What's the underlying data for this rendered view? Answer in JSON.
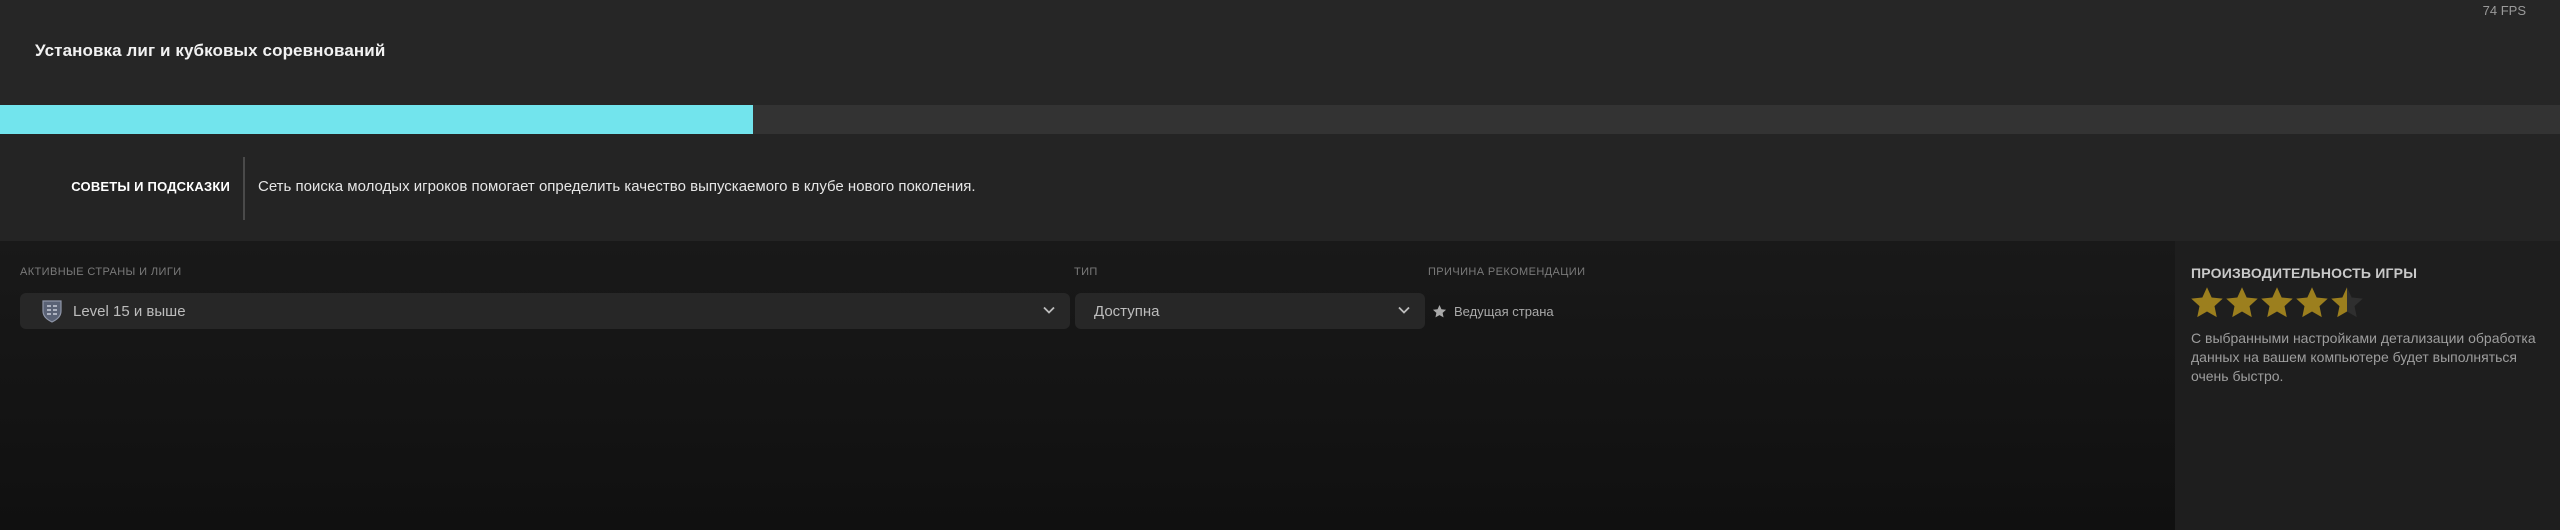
{
  "header": {
    "title": "Установка лиг и кубковых соревнований",
    "fps": "74 FPS"
  },
  "progress": {
    "fraction": 0.294,
    "color": "#72e4ed"
  },
  "tips": {
    "label": "СОВЕТЫ И ПОДСКАЗКИ",
    "text": "Сеть поиска молодых игроков помогает определить качество выпускаемого в клубе нового поколения."
  },
  "filters": {
    "leagues": {
      "label": "АКТИВНЫЕ СТРАНЫ И ЛИГИ",
      "value": "Level 15 и выше",
      "icon": "england-crest-icon"
    },
    "type": {
      "label": "ТИП",
      "value": "Доступна"
    },
    "reason": {
      "label": "ПРИЧИНА РЕКОМЕНДАЦИИ",
      "value": "Ведущая страна",
      "icon": "star-icon"
    }
  },
  "performance": {
    "title": "ПРОИЗВОДИТЕЛЬНОСТЬ ИГРЫ",
    "rating": 4.5,
    "max_rating": 5,
    "star_color": "#9c7f1e",
    "description": "С выбранными настройками детализации обработка данных на вашем компьютере будет выполняться очень быстро."
  }
}
